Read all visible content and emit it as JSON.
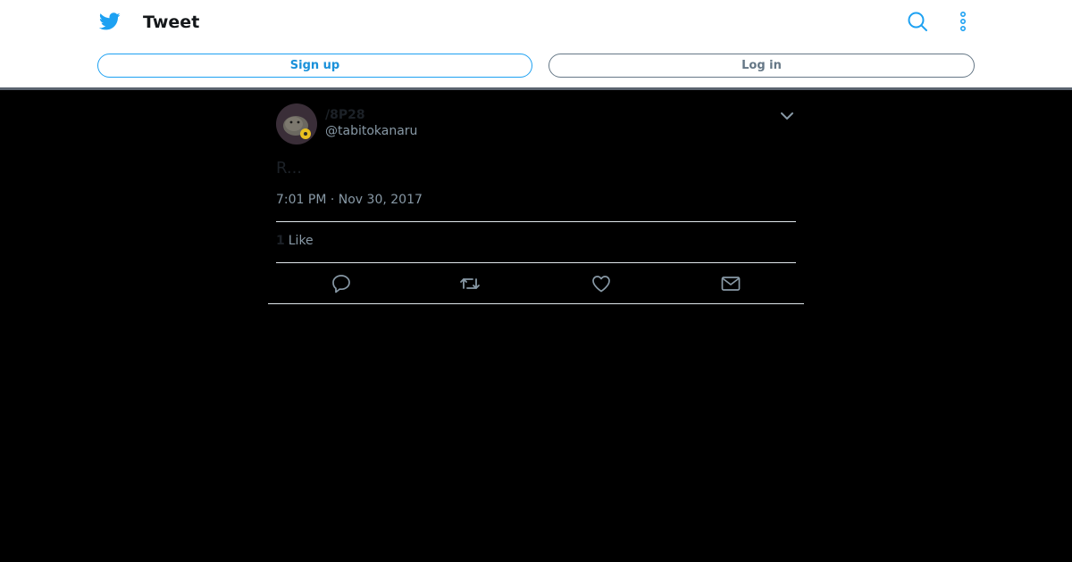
{
  "header": {
    "title": "Tweet",
    "icons": {
      "logo": "twitter-bird-icon",
      "search": "search-icon",
      "more": "more-vertical-icon"
    },
    "signup_label": "Sign up",
    "login_label": "Log in"
  },
  "tweet": {
    "display_name": "/8P28",
    "handle": "@tabitokanaru",
    "text": "R...",
    "timestamp": "7:01 PM · Nov 30, 2017",
    "like_count": "1",
    "like_label": "Like",
    "icons": [
      "reply-icon",
      "retweet-icon",
      "like-icon",
      "direct-message-icon"
    ]
  },
  "colors": {
    "brand": "#1da1f2",
    "background": "#000000",
    "muted": "#8899a6",
    "header_background": "#ffffff"
  }
}
